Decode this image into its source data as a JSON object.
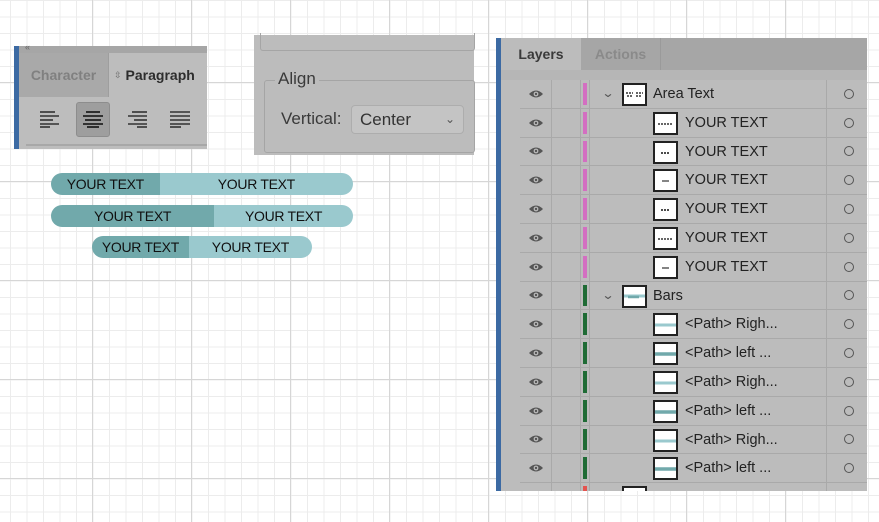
{
  "paragraph_panel": {
    "tabs": [
      {
        "label": "Character",
        "active": false
      },
      {
        "label": "Paragraph",
        "active": true
      }
    ],
    "collapse_glyph": "«",
    "updown_glyph": "⇳",
    "alignment_buttons": [
      {
        "name": "align-left",
        "selected": false
      },
      {
        "name": "align-center",
        "selected": true
      },
      {
        "name": "align-right",
        "selected": false
      },
      {
        "name": "justify",
        "selected": false
      }
    ]
  },
  "align_panel": {
    "group_title": "Align",
    "vertical_label": "Vertical:",
    "vertical_value": "Center",
    "chevron": "⌄"
  },
  "bars": [
    {
      "left_text": "YOUR TEXT",
      "right_text": "YOUR TEXT",
      "left_fraction": 0.36
    },
    {
      "left_text": "YOUR TEXT",
      "right_text": "YOUR TEXT",
      "left_fraction": 0.54
    },
    {
      "left_text": "YOUR TEXT",
      "right_text": "YOUR TEXT",
      "left_fraction": 0.44
    }
  ],
  "colors": {
    "bar_left": "#71a9ab",
    "bar_right": "#9ac9ce",
    "layer_pink": "#d36fc1",
    "layer_green": "#1f6b35",
    "layer_red": "#e4534f",
    "panel_accent": "#3c6aa3"
  },
  "layers_panel": {
    "tabs": [
      {
        "label": "Layers",
        "active": true
      },
      {
        "label": "Actions",
        "active": false
      }
    ],
    "rows": [
      {
        "level": "parent",
        "name": "Area Text",
        "color": "pink",
        "expanded": true,
        "thumb": "area-text"
      },
      {
        "level": "child",
        "name": "YOUR TEXT",
        "color": "pink",
        "thumb": "text-long"
      },
      {
        "level": "child",
        "name": "YOUR TEXT",
        "color": "pink",
        "thumb": "text-mid"
      },
      {
        "level": "child",
        "name": "YOUR TEXT",
        "color": "pink",
        "thumb": "text-short"
      },
      {
        "level": "child",
        "name": "YOUR TEXT",
        "color": "pink",
        "thumb": "text-mid"
      },
      {
        "level": "child",
        "name": "YOUR TEXT",
        "color": "pink",
        "thumb": "text-long"
      },
      {
        "level": "child",
        "name": "YOUR TEXT",
        "color": "pink",
        "thumb": "text-short"
      },
      {
        "level": "parent",
        "name": "Bars",
        "color": "green",
        "expanded": true,
        "thumb": "bars"
      },
      {
        "level": "child",
        "name": "<Path> Righ...",
        "color": "green",
        "thumb": "path-light"
      },
      {
        "level": "child",
        "name": "<Path> left ...",
        "color": "green",
        "thumb": "path-dark"
      },
      {
        "level": "child",
        "name": "<Path> Righ...",
        "color": "green",
        "thumb": "path-light"
      },
      {
        "level": "child",
        "name": "<Path> left ...",
        "color": "green",
        "thumb": "path-dark"
      },
      {
        "level": "child",
        "name": "<Path> Righ...",
        "color": "green",
        "thumb": "path-light"
      },
      {
        "level": "child",
        "name": "<Path> left ...",
        "color": "green",
        "thumb": "path-dark"
      },
      {
        "level": "parent",
        "name": "",
        "color": "red",
        "expanded": false,
        "thumb": "blank",
        "partial": true
      }
    ]
  }
}
